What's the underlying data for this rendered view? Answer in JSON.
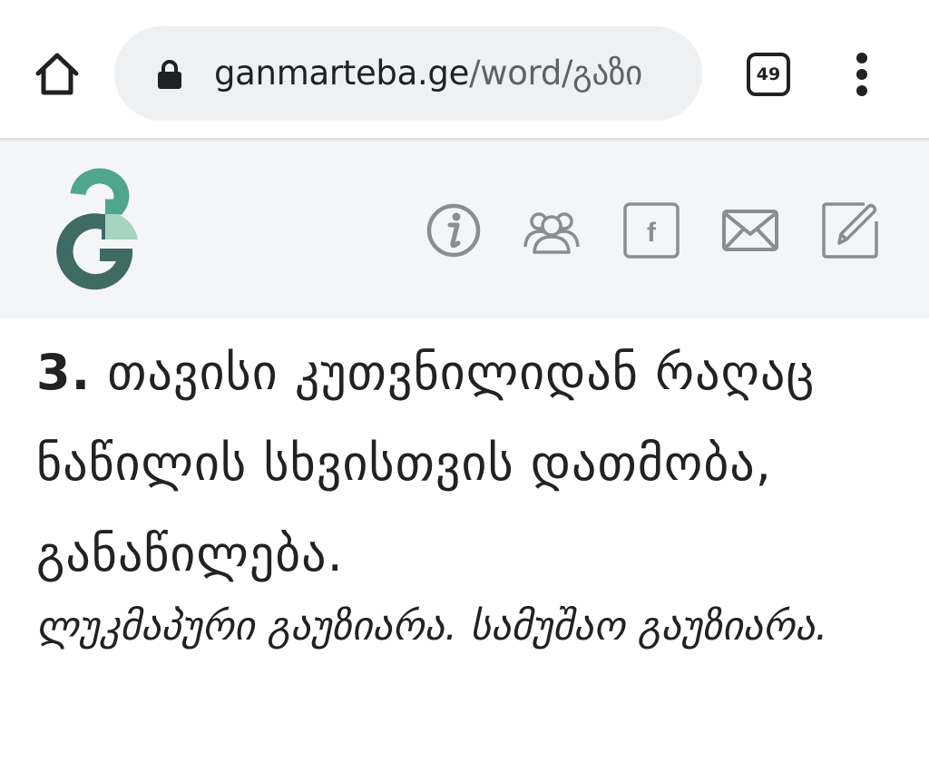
{
  "browser": {
    "url_domain": "ganmarteba.ge",
    "url_path": "/word/გაზი",
    "tab_count": "49",
    "icons": {
      "home": "home-icon",
      "lock": "lock-icon",
      "tabs": "tab-switcher-icon",
      "menu": "more-vert-icon"
    }
  },
  "site_header": {
    "icons": [
      "info-icon",
      "users-icon",
      "facebook-icon",
      "mail-icon",
      "edit-icon"
    ],
    "facebook_letter": "f",
    "logo_colors": {
      "primary": "#3f6b64",
      "accent": "#4fa58e",
      "light": "#a7d3c1"
    }
  },
  "definition": {
    "number": "3.",
    "text": " თავისი კუთვნილიდან რაღაც ნაწილის სხვისთვის დათმობა, განაწილება."
  },
  "examples": {
    "text": "ლუკმაპური გაუზიარა. სამუშაო გაუზიარა."
  },
  "colors": {
    "toolbar_bg": "#ffffff",
    "urlbar_bg": "#eef0f2",
    "header_bg": "#f4f5f7",
    "icon_gray": "#8a8d91",
    "text": "#222222"
  }
}
